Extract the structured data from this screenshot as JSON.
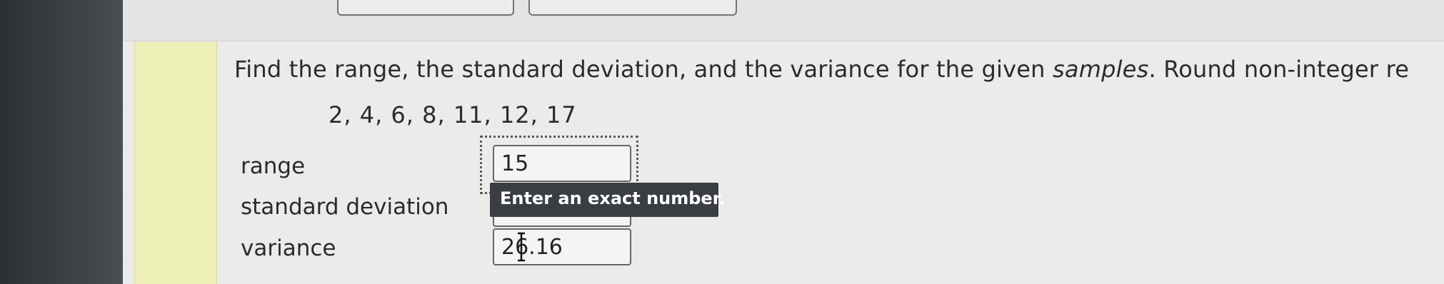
{
  "question": {
    "prefix": "Find the range, the standard deviation, and the variance for the given",
    "emphasis": "samples",
    "suffix": ". Round non-integer re"
  },
  "sample_values": "2, 4, 6, 8, 11, 12, 17",
  "fields": {
    "range": {
      "label": "range",
      "value": "15"
    },
    "standard_deviation": {
      "label": "standard deviation",
      "value": ""
    },
    "variance": {
      "label": "variance",
      "value": "26.16"
    }
  },
  "tooltip": {
    "text": "Enter an exact number."
  },
  "colors": {
    "accent_bar": "#ecefb6",
    "tooltip_bg": "#3a3e42"
  },
  "icons": {
    "cursor": "text-cursor-icon"
  }
}
